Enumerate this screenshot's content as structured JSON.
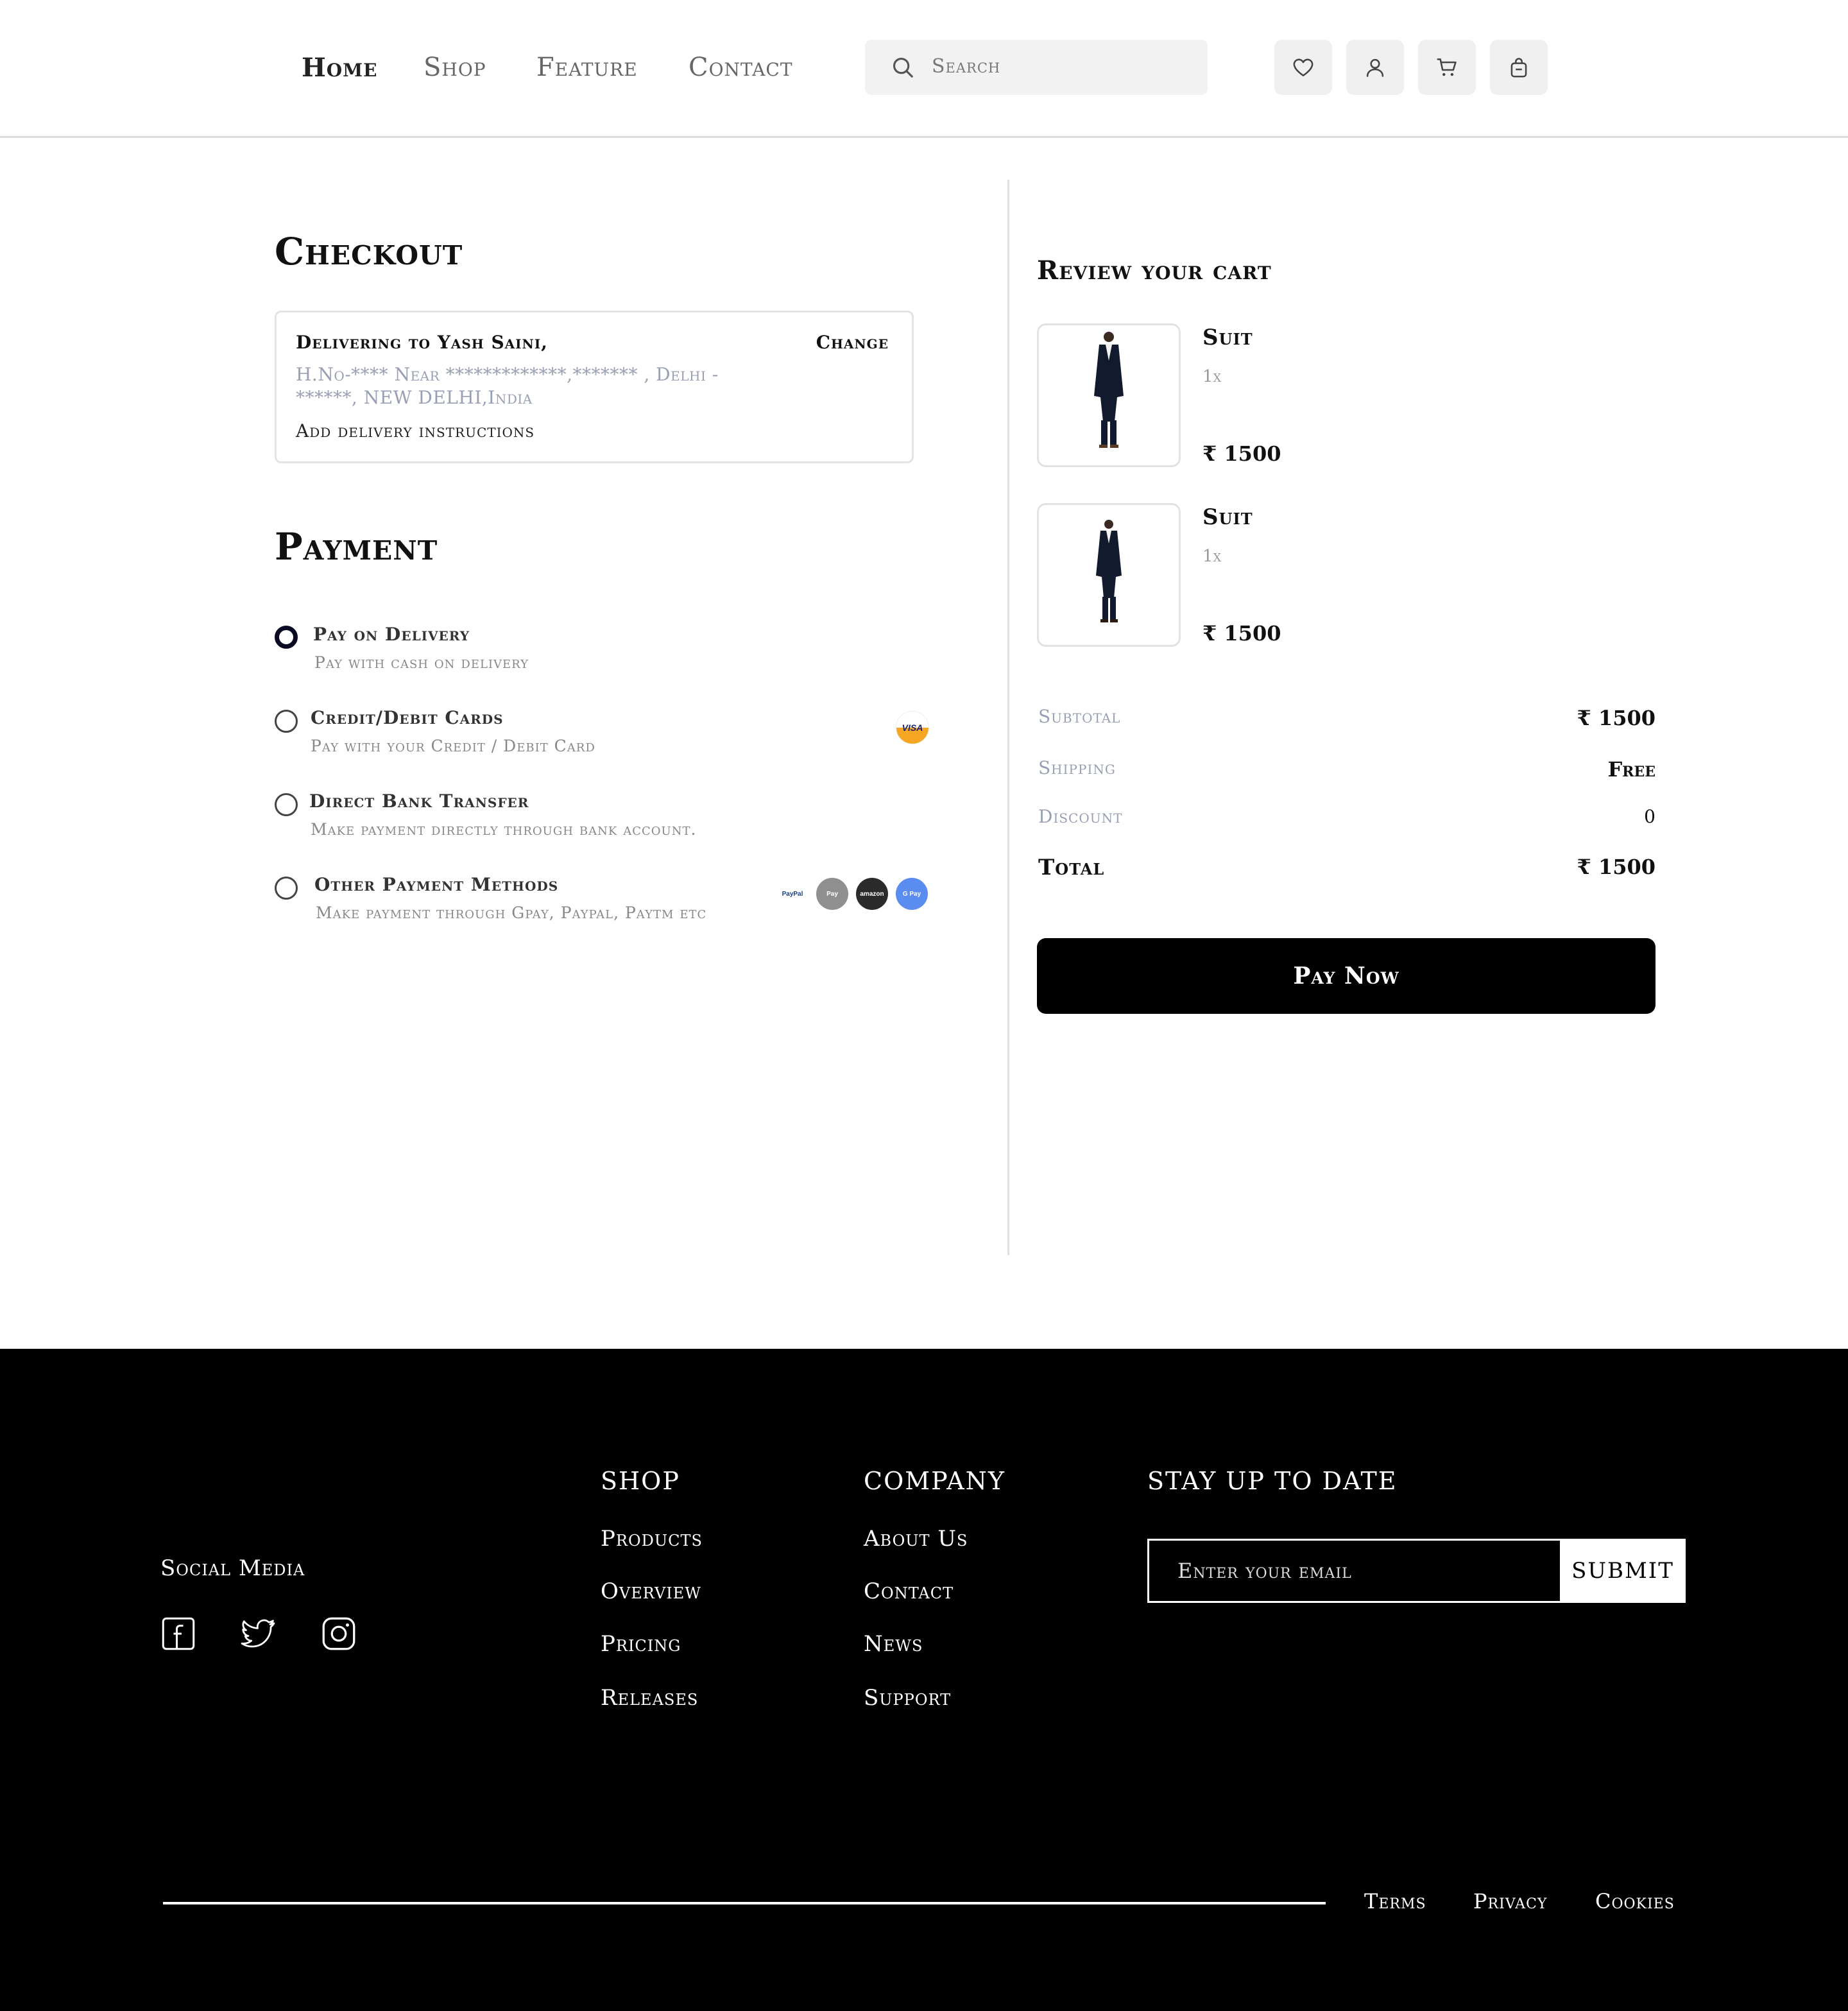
{
  "nav": {
    "links": [
      "Home",
      "Shop",
      "Feature",
      "Contact"
    ],
    "search_placeholder": "Search",
    "icons": [
      "heart-icon",
      "user-icon",
      "cart-icon",
      "bag-icon"
    ]
  },
  "checkout": {
    "title": "Checkout",
    "delivering_to": "Delivering to Yash Saini,",
    "change_label": "Change",
    "address_line1": "H.No-**** Near *************,******* , Delhi -",
    "address_line2": "******, NEW DELHI,India",
    "add_instructions": "Add delivery instructions"
  },
  "payment": {
    "title": "Payment",
    "options": [
      {
        "title": "Pay on Delivery",
        "subtitle": "Pay with cash on delivery",
        "selected": true
      },
      {
        "title": "Credit/Debit Cards",
        "subtitle": "Pay with your Credit / Debit Card",
        "selected": false,
        "badge": "VISA"
      },
      {
        "title": "Direct Bank Transfer",
        "subtitle": "Make payment directly through bank account.",
        "selected": false
      },
      {
        "title": "Other Payment Methods",
        "subtitle": "Make payment through Gpay, Paypal, Paytm etc",
        "selected": false,
        "badges": [
          "PayPal",
          "Pay",
          "amazon",
          "G Pay"
        ]
      }
    ]
  },
  "cart": {
    "title": "Review your cart",
    "items": [
      {
        "name": "Suit",
        "qty": "1x",
        "price": "₹ 1500"
      },
      {
        "name": "Suit",
        "qty": "1x",
        "price": "₹ 1500"
      }
    ],
    "summary": {
      "subtotal_label": "Subtotal",
      "subtotal_value": "₹ 1500",
      "shipping_label": "Shipping",
      "shipping_value": "Free",
      "discount_label": "Discount",
      "discount_value": "0",
      "total_label": "Total",
      "total_value": "₹ 1500"
    },
    "pay_now": "Pay Now"
  },
  "footer": {
    "social_title": "Social Media",
    "social_icons": [
      "facebook-icon",
      "twitter-icon",
      "instagram-icon"
    ],
    "shop_title": "SHOP",
    "shop_links": [
      "Products",
      "Overview",
      "Pricing",
      "Releases"
    ],
    "company_title": "COMPANY",
    "company_links": [
      "About Us",
      "Contact",
      "News",
      "Support"
    ],
    "newsletter_title": "STAY UP TO DATE",
    "email_placeholder": "Enter your email",
    "submit_label": "SUBMIT",
    "legal_links": [
      "Terms",
      "Privacy",
      "Cookies"
    ]
  },
  "colors": {
    "accent": "#000000",
    "muted_text": "#9aa0b3",
    "selected_radio": "#0a0a23"
  }
}
